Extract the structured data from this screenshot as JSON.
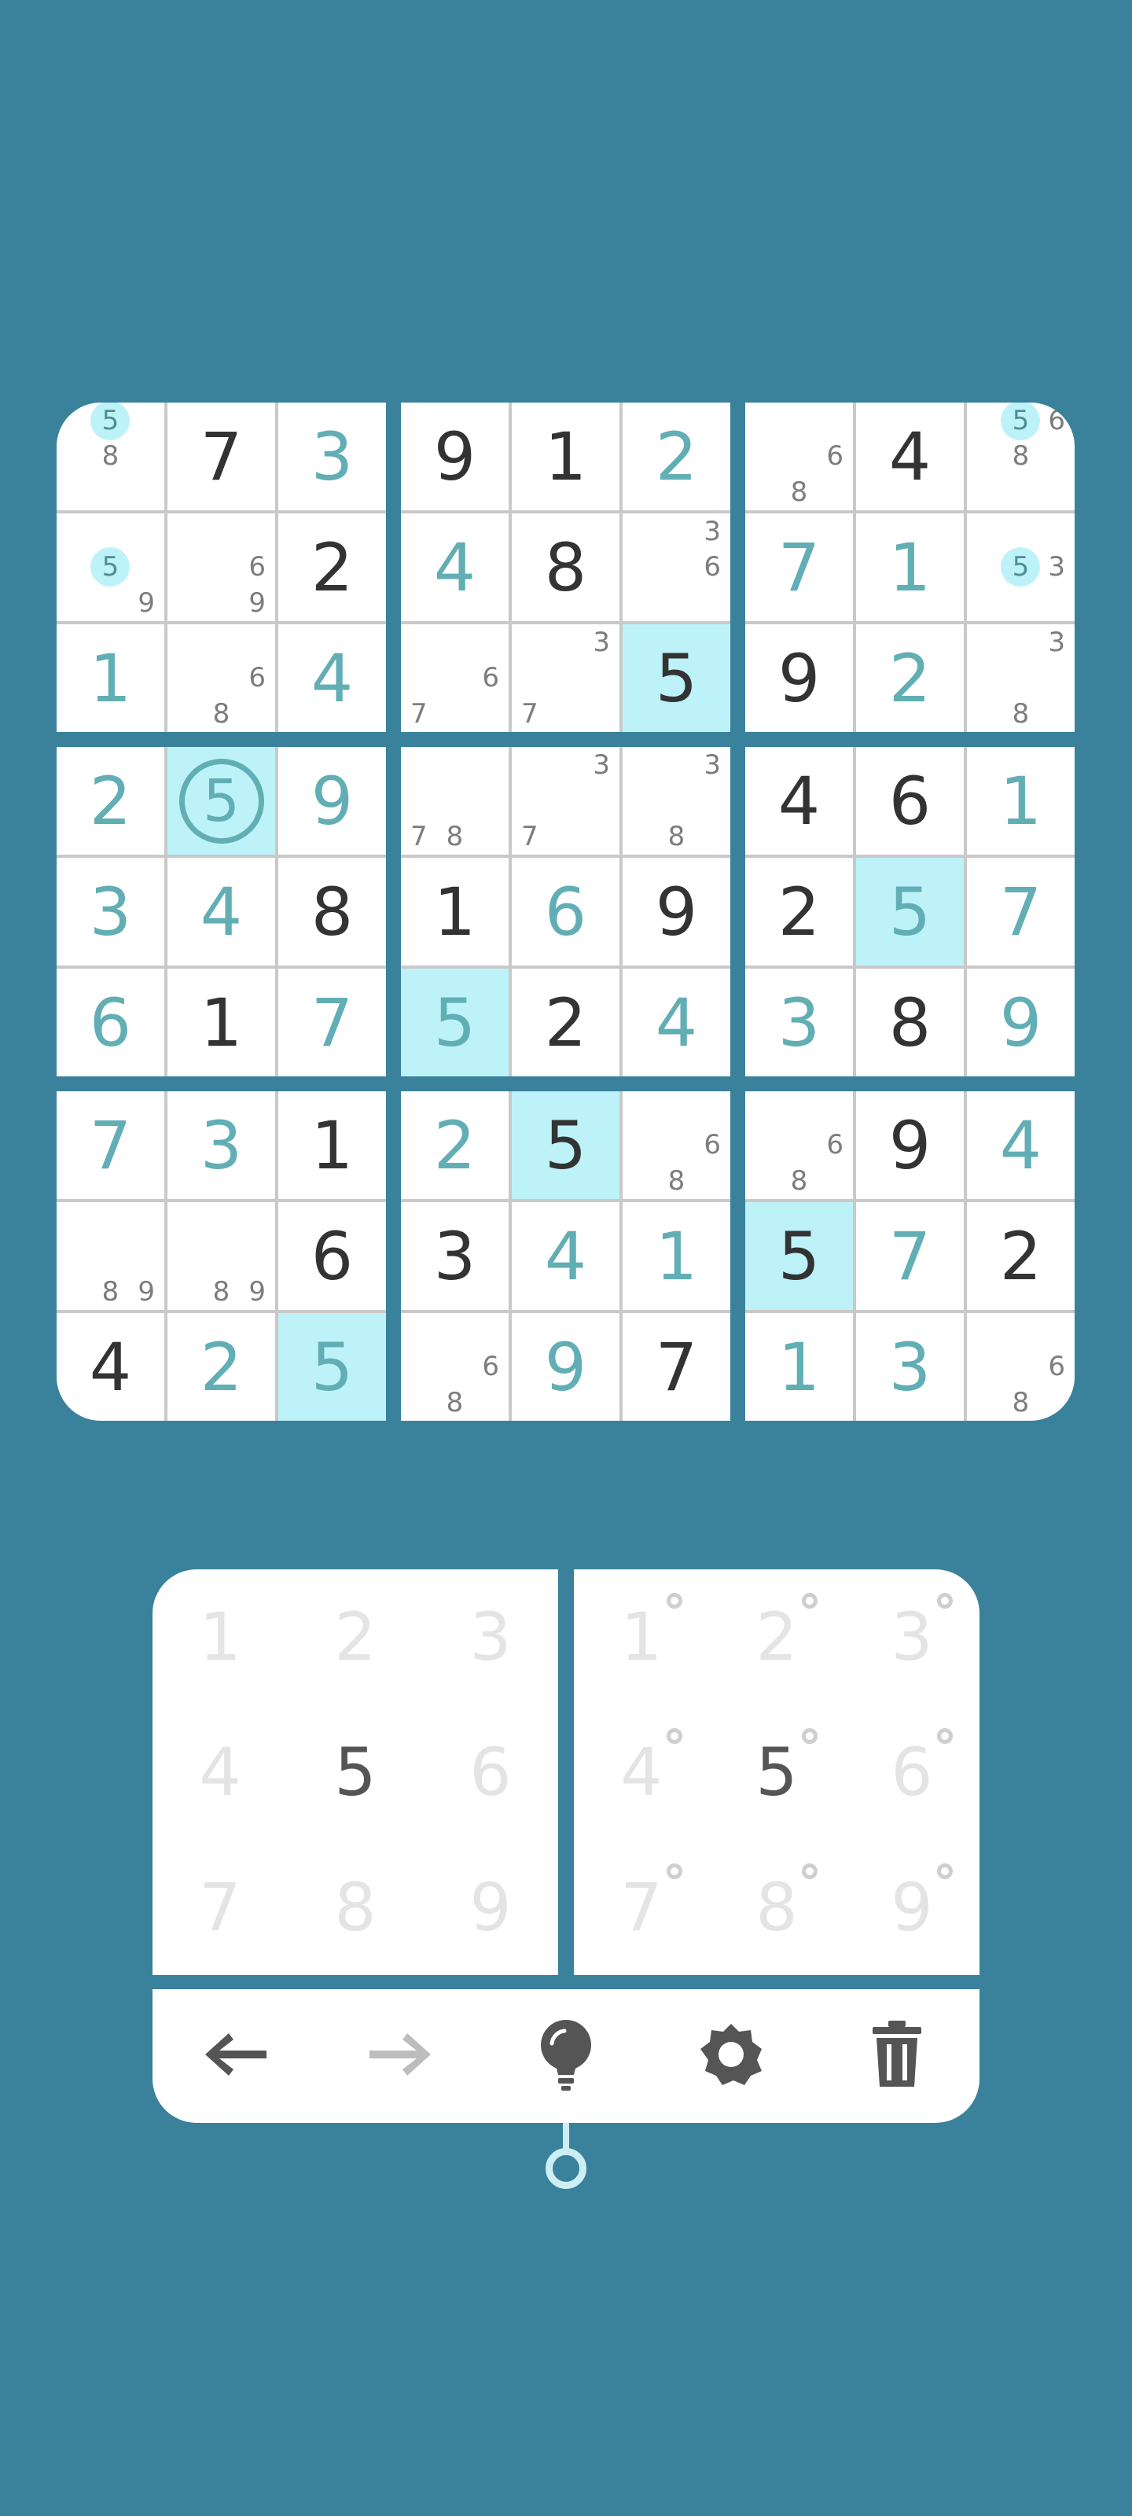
{
  "board": {
    "boxes": [
      [
        {
          "notes": [
            {
              "d": "5",
              "pos": 1,
              "hl": true
            },
            {
              "d": "8",
              "pos": 4
            }
          ]
        },
        {
          "value": "7",
          "kind": "given"
        },
        {
          "value": "3",
          "kind": "user"
        },
        {
          "notes": [
            {
              "d": "5",
              "pos": 4,
              "hl": true
            },
            {
              "d": "9",
              "pos": 8
            }
          ]
        },
        {
          "notes": [
            {
              "d": "6",
              "pos": 5
            },
            {
              "d": "9",
              "pos": 8
            }
          ]
        },
        {
          "value": "2",
          "kind": "given"
        },
        {
          "value": "1",
          "kind": "user"
        },
        {
          "notes": [
            {
              "d": "6",
              "pos": 5
            },
            {
              "d": "8",
              "pos": 7
            }
          ]
        },
        {
          "value": "4",
          "kind": "user"
        }
      ],
      [
        {
          "value": "9",
          "kind": "given"
        },
        {
          "value": "1",
          "kind": "given"
        },
        {
          "value": "2",
          "kind": "user"
        },
        {
          "value": "4",
          "kind": "user"
        },
        {
          "value": "8",
          "kind": "given"
        },
        {
          "notes": [
            {
              "d": "3",
              "pos": 2
            },
            {
              "d": "6",
              "pos": 5
            }
          ]
        },
        {
          "notes": [
            {
              "d": "6",
              "pos": 5
            },
            {
              "d": "7",
              "pos": 6
            }
          ]
        },
        {
          "notes": [
            {
              "d": "3",
              "pos": 2
            },
            {
              "d": "7",
              "pos": 6
            }
          ]
        },
        {
          "value": "5",
          "kind": "given",
          "hl": true
        }
      ],
      [
        {
          "notes": [
            {
              "d": "6",
              "pos": 5
            },
            {
              "d": "8",
              "pos": 7
            }
          ]
        },
        {
          "value": "4",
          "kind": "given"
        },
        {
          "notes": [
            {
              "d": "5",
              "pos": 1,
              "hl": true
            },
            {
              "d": "6",
              "pos": 2
            },
            {
              "d": "8",
              "pos": 4
            }
          ]
        },
        {
          "value": "7",
          "kind": "user"
        },
        {
          "value": "1",
          "kind": "user"
        },
        {
          "notes": [
            {
              "d": "3",
              "pos": 5
            },
            {
              "d": "5",
              "pos": 4,
              "hl": true
            }
          ]
        },
        {
          "value": "9",
          "kind": "given"
        },
        {
          "value": "2",
          "kind": "user"
        },
        {
          "notes": [
            {
              "d": "3",
              "pos": 2
            },
            {
              "d": "8",
              "pos": 7
            }
          ]
        }
      ],
      [
        {
          "value": "2",
          "kind": "user"
        },
        {
          "value": "5",
          "kind": "user",
          "hl": true,
          "selected": true
        },
        {
          "value": "9",
          "kind": "user"
        },
        {
          "value": "3",
          "kind": "user"
        },
        {
          "value": "4",
          "kind": "user"
        },
        {
          "value": "8",
          "kind": "given"
        },
        {
          "value": "6",
          "kind": "user"
        },
        {
          "value": "1",
          "kind": "given"
        },
        {
          "value": "7",
          "kind": "user"
        }
      ],
      [
        {
          "notes": [
            {
              "d": "7",
              "pos": 6
            },
            {
              "d": "8",
              "pos": 7
            }
          ]
        },
        {
          "notes": [
            {
              "d": "3",
              "pos": 2
            },
            {
              "d": "7",
              "pos": 6
            }
          ]
        },
        {
          "notes": [
            {
              "d": "3",
              "pos": 2
            },
            {
              "d": "8",
              "pos": 7
            }
          ]
        },
        {
          "value": "1",
          "kind": "given"
        },
        {
          "value": "6",
          "kind": "user"
        },
        {
          "value": "9",
          "kind": "given"
        },
        {
          "value": "5",
          "kind": "user",
          "hl": true
        },
        {
          "value": "2",
          "kind": "given"
        },
        {
          "value": "4",
          "kind": "user"
        }
      ],
      [
        {
          "value": "4",
          "kind": "given"
        },
        {
          "value": "6",
          "kind": "given"
        },
        {
          "value": "1",
          "kind": "user"
        },
        {
          "value": "2",
          "kind": "given"
        },
        {
          "value": "5",
          "kind": "user",
          "hl": true
        },
        {
          "value": "7",
          "kind": "user"
        },
        {
          "value": "3",
          "kind": "user"
        },
        {
          "value": "8",
          "kind": "given"
        },
        {
          "value": "9",
          "kind": "user"
        }
      ],
      [
        {
          "value": "7",
          "kind": "user"
        },
        {
          "value": "3",
          "kind": "user"
        },
        {
          "value": "1",
          "kind": "given"
        },
        {
          "notes": [
            {
              "d": "8",
              "pos": 7
            },
            {
              "d": "9",
              "pos": 8
            }
          ]
        },
        {
          "notes": [
            {
              "d": "8",
              "pos": 7
            },
            {
              "d": "9",
              "pos": 8
            }
          ]
        },
        {
          "value": "6",
          "kind": "given"
        },
        {
          "value": "4",
          "kind": "given"
        },
        {
          "value": "2",
          "kind": "user"
        },
        {
          "value": "5",
          "kind": "user",
          "hl": true
        }
      ],
      [
        {
          "value": "2",
          "kind": "user"
        },
        {
          "value": "5",
          "kind": "given",
          "hl": true
        },
        {
          "notes": [
            {
              "d": "6",
              "pos": 5
            },
            {
              "d": "8",
              "pos": 7
            }
          ]
        },
        {
          "value": "3",
          "kind": "given"
        },
        {
          "value": "4",
          "kind": "user"
        },
        {
          "value": "1",
          "kind": "user"
        },
        {
          "notes": [
            {
              "d": "6",
              "pos": 5
            },
            {
              "d": "8",
              "pos": 7
            }
          ]
        },
        {
          "value": "9",
          "kind": "user"
        },
        {
          "value": "7",
          "kind": "given"
        }
      ],
      [
        {
          "notes": [
            {
              "d": "6",
              "pos": 5
            },
            {
              "d": "8",
              "pos": 7
            }
          ]
        },
        {
          "value": "9",
          "kind": "given"
        },
        {
          "value": "4",
          "kind": "user"
        },
        {
          "value": "5",
          "kind": "given",
          "hl": true
        },
        {
          "value": "7",
          "kind": "user"
        },
        {
          "value": "2",
          "kind": "given"
        },
        {
          "value": "1",
          "kind": "user"
        },
        {
          "value": "3",
          "kind": "user"
        },
        {
          "notes": [
            {
              "d": "6",
              "pos": 5
            },
            {
              "d": "8",
              "pos": 7
            }
          ]
        }
      ]
    ]
  },
  "numpad": {
    "keys": [
      "1",
      "2",
      "3",
      "4",
      "5",
      "6",
      "7",
      "8",
      "9"
    ],
    "active": "5"
  },
  "notepad": {
    "keys": [
      "1",
      "2",
      "3",
      "4",
      "5",
      "6",
      "7",
      "8",
      "9"
    ],
    "active": "5"
  },
  "toolbar": [
    {
      "name": "undo-button",
      "icon": "arrow-left-icon",
      "enabled": true
    },
    {
      "name": "redo-button",
      "icon": "arrow-right-icon",
      "enabled": false
    },
    {
      "name": "hint-button",
      "icon": "lightbulb-icon",
      "enabled": true
    },
    {
      "name": "settings-button",
      "icon": "gear-icon",
      "enabled": true
    },
    {
      "name": "erase-button",
      "icon": "trash-icon",
      "enabled": true
    }
  ],
  "colors": {
    "background": "#3a819c",
    "given_digit": "#333333",
    "user_digit": "#62aeb5",
    "highlight": "#bdf3f8",
    "note": "#7d7d7d"
  }
}
